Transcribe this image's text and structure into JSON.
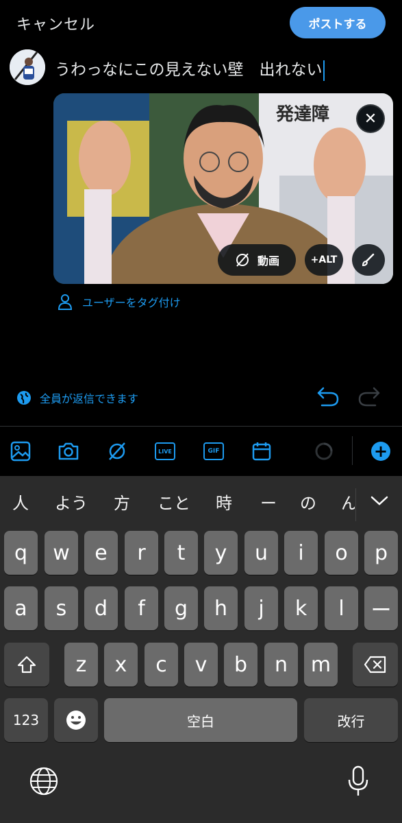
{
  "header": {
    "cancel_label": "キャンセル",
    "post_label": "ポストする"
  },
  "composer": {
    "text": "うわっなにこの見えない壁　出れない"
  },
  "media": {
    "overlay_text": "発達障",
    "video_label": "動画",
    "alt_label": "+ALT"
  },
  "tag_users_label": "ユーザーをタグ付け",
  "reply_setting_label": "全員が返信できます",
  "toolbar": {
    "icons": [
      "image-icon",
      "camera-icon",
      "video-edit-icon",
      "live-icon",
      "gif-icon",
      "schedule-icon"
    ],
    "live_label": "LIVE",
    "gif_label": "GIF"
  },
  "keyboard": {
    "candidates": [
      "人",
      "よう",
      "方",
      "こと",
      "時",
      "ー",
      "の",
      "ん"
    ],
    "row1": [
      "q",
      "w",
      "e",
      "r",
      "t",
      "y",
      "u",
      "i",
      "o",
      "p"
    ],
    "row2": [
      "a",
      "s",
      "d",
      "f",
      "g",
      "h",
      "j",
      "k",
      "l",
      "ー"
    ],
    "row3": [
      "z",
      "x",
      "c",
      "v",
      "b",
      "n",
      "m"
    ],
    "numbers_label": "123",
    "space_label": "空白",
    "return_label": "改行"
  },
  "colors": {
    "accent": "#1d9bf0",
    "post_button": "#4a99e9",
    "background": "#000000",
    "keyboard_bg": "#2b2b2b",
    "key": "#6b6b6b"
  }
}
